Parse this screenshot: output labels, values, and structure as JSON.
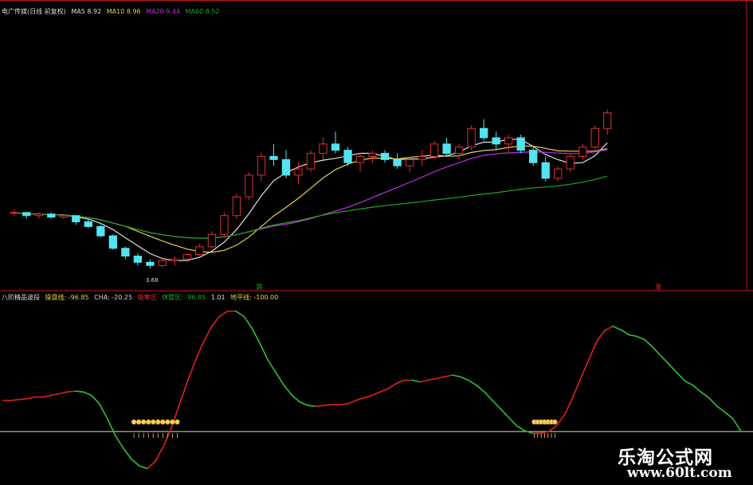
{
  "colors": {
    "background": "#000000",
    "candle_up": "#e03030",
    "candle_down": "#54e4f0",
    "ma5": "#e0e0e0",
    "ma10": "#e6d24a",
    "ma20": "#c030e0",
    "ma60": "#1fa81f",
    "osc_up": "#e02020",
    "osc_down": "#30c030",
    "baseline": "#e8e0b0",
    "divider": "#c01818"
  },
  "upper": {
    "title": "电广传媒(日线 前复权)",
    "ma_labels": [
      {
        "text": "MA5 8.92",
        "color": "#e0e0e0"
      },
      {
        "text": "MA10 8.96",
        "color": "#e6d24a"
      },
      {
        "text": "MA20 9.44",
        "color": "#c030e0"
      },
      {
        "text": "MA60 8.52",
        "color": "#1fa81f"
      }
    ],
    "low_marker": "3.68",
    "markers": [
      {
        "text": "跌",
        "color": "#1fa81f"
      },
      {
        "text": "涨",
        "color": "#e03030"
      }
    ]
  },
  "lower": {
    "title": "八阶精品波段",
    "items": [
      {
        "text": "操盘线: -96.85",
        "color": "#e6d24a"
      },
      {
        "text": "CHA: -20.25",
        "color": "#dddddd"
      },
      {
        "text": "吸筹区",
        "color": "#e03030"
      },
      {
        "text": "休整区: -96.85",
        "color": "#1fa81f"
      },
      {
        "text": "1.01",
        "color": "#dddddd"
      },
      {
        "text": "地平线: -100.00",
        "color": "#e6d24a"
      }
    ]
  },
  "watermark": {
    "title": "乐淘公式网",
    "url": "www.60lt.com"
  },
  "chart_data": {
    "type": "line",
    "series": [
      {
        "name": "操盘线",
        "x": [
          0,
          1,
          2,
          3,
          4,
          5,
          6,
          7,
          8,
          9,
          10,
          11,
          12,
          13,
          14,
          15,
          16,
          17,
          18,
          19,
          20,
          21,
          22,
          23,
          24,
          25,
          26,
          27,
          28,
          29,
          30,
          31,
          32,
          33,
          34,
          35,
          36,
          37,
          38,
          39,
          40,
          41,
          42,
          43,
          44,
          45,
          46,
          47,
          48,
          49,
          50,
          51,
          52,
          53,
          54,
          55,
          56,
          57,
          58,
          59,
          60,
          61,
          62,
          63,
          64,
          65,
          66,
          67,
          68,
          69,
          70,
          71,
          72,
          73,
          74,
          75,
          76,
          77,
          78,
          79,
          80,
          81,
          82,
          83,
          84,
          85,
          86,
          87,
          88,
          89,
          90,
          91,
          92
        ],
        "y": [
          -18,
          -18,
          -17,
          -16,
          -14,
          -14,
          -12,
          -10,
          -8,
          -7,
          -8,
          -12,
          -22,
          -40,
          -60,
          -75,
          -88,
          -96,
          -99,
          -90,
          -72,
          -50,
          -22,
          5,
          30,
          52,
          70,
          82,
          88,
          88,
          82,
          68,
          50,
          30,
          15,
          0,
          -12,
          -20,
          -24,
          -25,
          -24,
          -23,
          -23,
          -22,
          -18,
          -15,
          -12,
          -8,
          -4,
          2,
          6,
          6,
          4,
          6,
          8,
          10,
          12,
          10,
          6,
          0,
          -8,
          -18,
          -28,
          -38,
          -48,
          -54,
          -57,
          -57,
          -55,
          -48,
          -35,
          -15,
          8,
          30,
          52,
          65,
          70,
          66,
          60,
          58,
          54,
          45,
          35,
          25,
          15,
          5,
          0,
          -8,
          -15,
          -25,
          -32,
          -40,
          -55
        ],
        "up_down": "red when rising, green when falling"
      }
    ],
    "ylim": [
      -110,
      100
    ],
    "baseline_value": -55,
    "buy_zones": [
      {
        "from": 16,
        "to": 22,
        "markers": 10
      },
      {
        "from": 66,
        "to": 69,
        "markers": 7
      }
    ],
    "candles": [
      [
        9.0,
        9.1,
        8.9,
        9.0
      ],
      [
        9.0,
        9.0,
        8.8,
        8.9
      ],
      [
        8.9,
        9.0,
        8.8,
        8.95
      ],
      [
        8.95,
        9.0,
        8.8,
        8.85
      ],
      [
        8.85,
        8.95,
        8.8,
        8.9
      ],
      [
        8.9,
        8.9,
        8.6,
        8.7
      ],
      [
        8.7,
        8.8,
        8.5,
        8.55
      ],
      [
        8.55,
        8.6,
        8.2,
        8.25
      ],
      [
        8.25,
        8.3,
        7.8,
        7.85
      ],
      [
        7.85,
        7.9,
        7.5,
        7.6
      ],
      [
        7.6,
        7.7,
        7.3,
        7.4
      ],
      [
        7.4,
        7.5,
        7.2,
        7.3
      ],
      [
        7.3,
        7.5,
        7.25,
        7.45
      ],
      [
        7.45,
        7.6,
        7.3,
        7.5
      ],
      [
        7.5,
        7.7,
        7.4,
        7.65
      ],
      [
        7.65,
        8.0,
        7.6,
        7.9
      ],
      [
        7.9,
        8.4,
        7.85,
        8.3
      ],
      [
        8.3,
        9.0,
        8.2,
        8.9
      ],
      [
        8.9,
        9.6,
        8.8,
        9.5
      ],
      [
        9.5,
        10.3,
        9.4,
        10.2
      ],
      [
        10.2,
        10.9,
        10.0,
        10.8
      ],
      [
        10.8,
        11.2,
        10.5,
        10.7
      ],
      [
        10.7,
        11.0,
        10.1,
        10.2
      ],
      [
        10.2,
        10.6,
        9.9,
        10.4
      ],
      [
        10.4,
        11.0,
        10.3,
        10.9
      ],
      [
        10.9,
        11.4,
        10.7,
        11.2
      ],
      [
        11.2,
        11.6,
        10.9,
        11.0
      ],
      [
        11.0,
        11.1,
        10.5,
        10.6
      ],
      [
        10.6,
        10.9,
        10.3,
        10.8
      ],
      [
        10.8,
        11.0,
        10.6,
        10.9
      ],
      [
        10.9,
        11.0,
        10.6,
        10.7
      ],
      [
        10.7,
        10.9,
        10.4,
        10.5
      ],
      [
        10.5,
        10.8,
        10.3,
        10.7
      ],
      [
        10.7,
        11.0,
        10.5,
        10.8
      ],
      [
        10.8,
        11.3,
        10.7,
        11.2
      ],
      [
        11.2,
        11.4,
        10.8,
        10.9
      ],
      [
        10.9,
        11.2,
        10.7,
        11.1
      ],
      [
        11.1,
        11.8,
        11.0,
        11.7
      ],
      [
        11.7,
        12.0,
        11.3,
        11.4
      ],
      [
        11.4,
        11.6,
        11.0,
        11.2
      ],
      [
        11.2,
        11.5,
        10.9,
        11.4
      ],
      [
        11.4,
        11.5,
        10.9,
        11.0
      ],
      [
        11.0,
        11.1,
        10.5,
        10.6
      ],
      [
        10.6,
        10.8,
        10.0,
        10.1
      ],
      [
        10.1,
        10.5,
        10.0,
        10.4
      ],
      [
        10.4,
        10.9,
        10.3,
        10.8
      ],
      [
        10.8,
        11.2,
        10.7,
        11.1
      ],
      [
        11.1,
        11.8,
        11.0,
        11.7
      ],
      [
        11.7,
        12.3,
        11.5,
        12.2
      ]
    ]
  }
}
